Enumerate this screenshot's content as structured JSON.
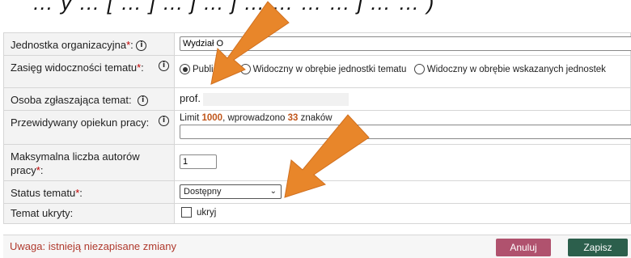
{
  "top_cut_text": "…  y   …  [ … ] …  j … j  …  …  …  …  j  …  …  )",
  "form": {
    "unit": {
      "label": "Jednostka organizacyjna",
      "req": "*",
      "value": "Wydział O"
    },
    "visibility": {
      "label": "Zasięg widoczności tematu",
      "req": "*",
      "options": [
        "Publiczny",
        "Widoczny w obrębie jednostki tematu",
        "Widoczny w obrębie wskazanych jednostek"
      ],
      "selected": "Publiczny"
    },
    "reporter": {
      "label": "Osoba zgłaszająca temat:",
      "value": "prof."
    },
    "supervisor": {
      "label": "Przewidywany opiekun pracy:",
      "limit_prefix": "Limit ",
      "limit": "1000",
      "limit_mid": ", wprowadzono ",
      "entered": "33",
      "limit_suffix": " znaków"
    },
    "max_authors": {
      "label": "Maksymalna liczba autorów pracy",
      "req": "*",
      "value": "1"
    },
    "status": {
      "label": "Status tematu",
      "req": "*",
      "selected": "Dostępny"
    },
    "hidden": {
      "label": "Temat ukryty:",
      "checkbox_label": "ukryj"
    }
  },
  "footer": {
    "warning": "Uwaga: istnieją niezapisane zmiany",
    "cancel_label": "Anuluj",
    "save_label": "Zapisz"
  },
  "colors": {
    "arrow": "#e8862a",
    "cancel": "#b0526e",
    "save": "#2c5f4c",
    "required": "#c00000"
  },
  "icons": {
    "info": "info-circle-icon",
    "select": "chevron-down-icon"
  }
}
